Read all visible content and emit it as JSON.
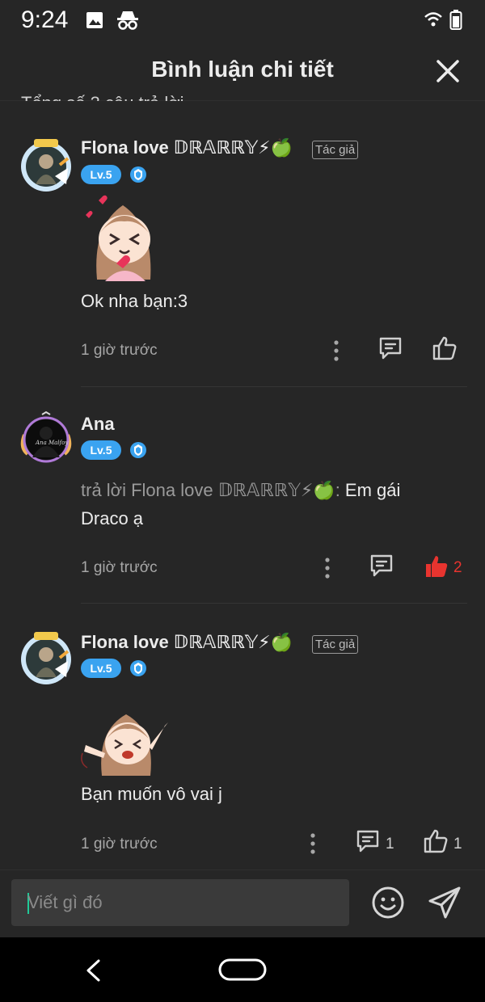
{
  "status": {
    "time": "9:24"
  },
  "header": {
    "title": "Bình luận chi tiết"
  },
  "summary": {
    "partial_text": "Tổng số 3 câu trả lời"
  },
  "comments": [
    {
      "author": "Flona love 𝔻ℝ𝔸ℝℝ𝕐⚡🍏",
      "tag": "Tác giả",
      "level": "Lv.5",
      "text": "Ok nha bạn:3",
      "time": "1 giờ trước",
      "likes": ""
    },
    {
      "author": "Ana",
      "level": "Lv.5",
      "reply_prefix": "trả lời Flona love 𝔻ℝ𝔸ℝℝ𝕐⚡🍏:",
      "text_line1": " Em gái",
      "text_line2": "Draco ạ",
      "time": "1 giờ trước",
      "likes": "2"
    },
    {
      "author": "Flona love 𝔻ℝ𝔸ℝℝ𝕐⚡🍏",
      "tag": "Tác giả",
      "level": "Lv.5",
      "text": "Bạn muốn vô vai j",
      "time": "1 giờ trước",
      "replies": "1",
      "likes": "1"
    }
  ],
  "composer": {
    "placeholder": "Viết gì đó"
  },
  "colors": {
    "accent_blue": "#3aa3f0",
    "like_red": "#e8342f",
    "background": "#262626"
  }
}
